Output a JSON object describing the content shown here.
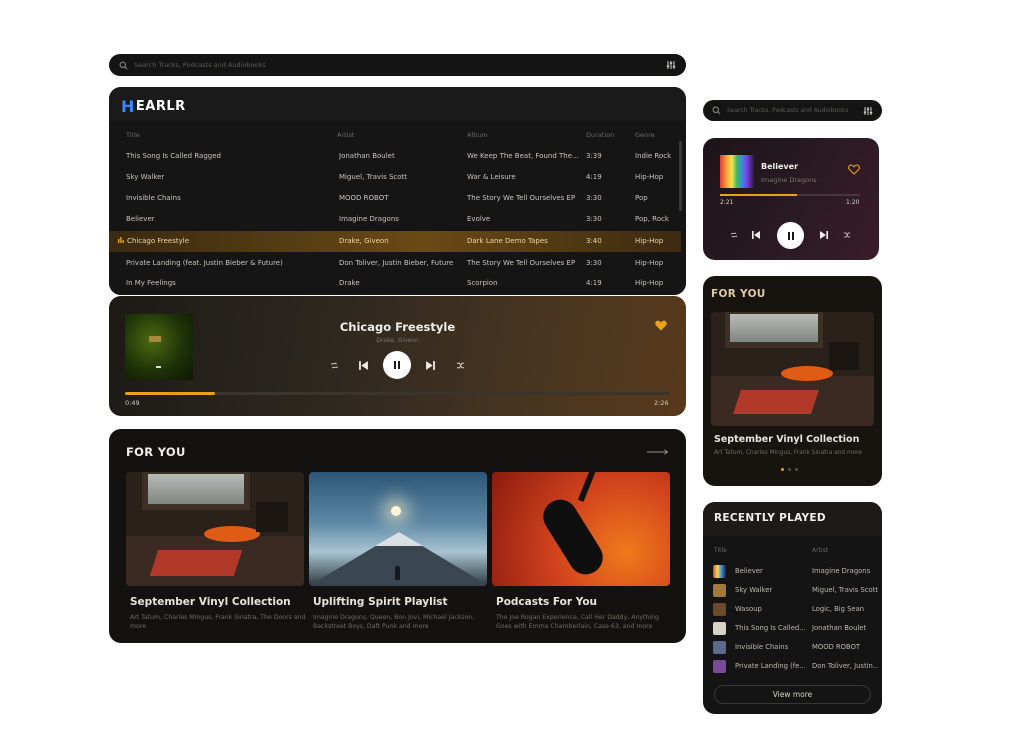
{
  "search": {
    "placeholder": "Search Tracks, Podcasts and Audiobooks"
  },
  "brand": {
    "logo": "EARLR",
    "logo_initial": "H"
  },
  "tracklist": {
    "columns": [
      "Title",
      "Artist",
      "Album",
      "Duration",
      "Genre"
    ],
    "rows": [
      {
        "title": "This Song Is Called Ragged",
        "artist": "Jonathan Boulet",
        "album": "We Keep The Beat, Found The...",
        "duration": "3:39",
        "genre": "Indie Rock"
      },
      {
        "title": "Sky Walker",
        "artist": "Miguel, Travis Scott",
        "album": "War & Leisure",
        "duration": "4:19",
        "genre": "Hip-Hop"
      },
      {
        "title": "Invisible Chains",
        "artist": "MOOD ROBOT",
        "album": "The Story We Tell Ourselves EP",
        "duration": "3:30",
        "genre": "Pop"
      },
      {
        "title": "Believer",
        "artist": "Imagine Dragons",
        "album": "Evolve",
        "duration": "3:30",
        "genre": "Pop, Rock"
      },
      {
        "title": "Chicago Freestyle",
        "artist": "Drake, Giveon",
        "album": "Dark Lane Demo Tapes",
        "duration": "3:40",
        "genre": "Hip-Hop",
        "active": true
      },
      {
        "title": "Private Landing (feat. Justin Bieber & Future)",
        "artist": "Don Toliver, Justin Bieber, Future",
        "album": "The Story We Tell Ourselves EP",
        "duration": "3:30",
        "genre": "Hip-Hop"
      },
      {
        "title": "In My Feelings",
        "artist": "Drake",
        "album": "Scorpion",
        "duration": "4:19",
        "genre": "Hip-Hop"
      }
    ]
  },
  "player_main": {
    "title": "Chicago Freestyle",
    "artist": "Drake, Giveon",
    "elapsed": "0:49",
    "total": "2:26",
    "progress": 0.165,
    "liked": true
  },
  "player_mini": {
    "title": "Believer",
    "artist": "Imagine Dragons",
    "elapsed": "2:21",
    "total": "1:20",
    "progress": 0.55,
    "liked": false
  },
  "for_you": {
    "title": "FOR YOU",
    "cards": [
      {
        "title": "September Vinyl Collection",
        "subtitle": "Art Tatum, Charles Mingus, Frank Sinatra, The Doors and more"
      },
      {
        "title": "Uplifting Spirit Playlist",
        "subtitle": "Imagine Dragons, Queen, Bon Jovi, Michael Jackson, Backstreet Boys, Daft Punk and more"
      },
      {
        "title": "Podcasts For You",
        "subtitle": "The Joe Rogan Experience, Call Her Daddy, Anything Goes with Emma Chamberlain, Case 63, and more"
      }
    ]
  },
  "for_you_mobile": {
    "title": "FOR YOU",
    "card_title": "September Vinyl Collection",
    "card_subtitle": "Art Tatum, Charles Mingus, Frank Sinatra and more",
    "page_count": 3,
    "active_page": 1
  },
  "recently_played": {
    "title": "RECENTLY PLAYED",
    "columns": [
      "Title",
      "Artist"
    ],
    "rows": [
      {
        "title": "Believer",
        "artist": "Imagine Dragons"
      },
      {
        "title": "Sky Walker",
        "artist": "Miguel, Travis Scott"
      },
      {
        "title": "Wasoup",
        "artist": "Logic, Big Sean"
      },
      {
        "title": "This Song Is Called...",
        "artist": "Jonathan Boulet"
      },
      {
        "title": "Invisible Chains",
        "artist": "MOOD ROBOT"
      },
      {
        "title": "Private Landing (fe...",
        "artist": "Don Toliver, Justin..."
      }
    ],
    "view_more": "View more"
  },
  "colors": {
    "accent": "#e8a21a",
    "panel": "#141414",
    "logo_blue": "#3a86ff"
  }
}
